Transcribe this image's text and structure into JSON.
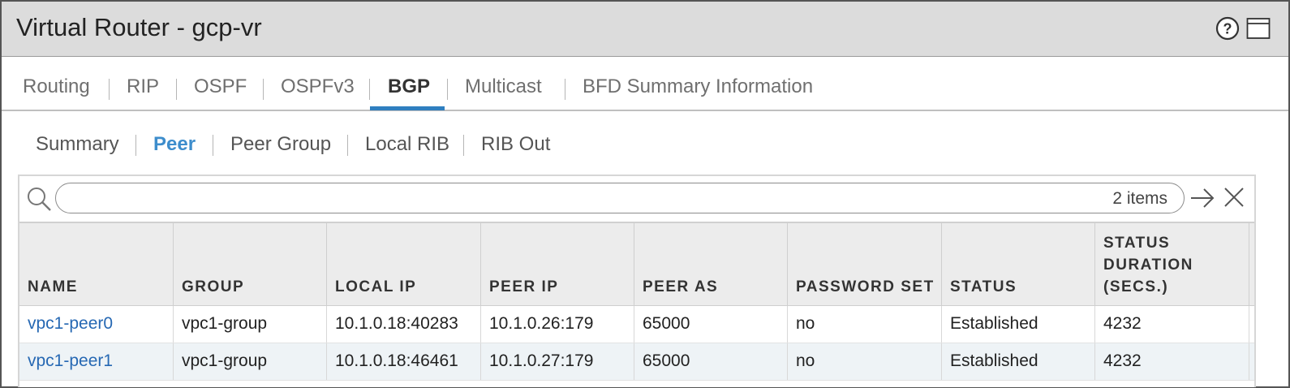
{
  "window": {
    "title": "Virtual Router - gcp-vr"
  },
  "tabs": [
    {
      "label": "Routing"
    },
    {
      "label": "RIP"
    },
    {
      "label": "OSPF"
    },
    {
      "label": "OSPFv3"
    },
    {
      "label": "BGP",
      "active": true
    },
    {
      "label": "Multicast"
    },
    {
      "label": "BFD Summary Information"
    }
  ],
  "subtabs": [
    {
      "label": "Summary"
    },
    {
      "label": "Peer",
      "active": true
    },
    {
      "label": "Peer Group"
    },
    {
      "label": "Local RIB"
    },
    {
      "label": "RIB Out"
    }
  ],
  "filter": {
    "value": "",
    "count": "2 items"
  },
  "table": {
    "columns": [
      "NAME",
      "GROUP",
      "LOCAL IP",
      "PEER IP",
      "PEER AS",
      "PASSWORD SET",
      "STATUS",
      "STATUS DURATION (SECS.)"
    ],
    "duration_header_lines": [
      "STATUS",
      "DURATION",
      "(SECS.)"
    ],
    "rows": [
      [
        "vpc1-peer0",
        "vpc1-group",
        "10.1.0.18:40283",
        "10.1.0.26:179",
        "65000",
        "no",
        "Established",
        "4232"
      ],
      [
        "vpc1-peer1",
        "vpc1-group",
        "10.1.0.18:46461",
        "10.1.0.27:179",
        "65000",
        "no",
        "Established",
        "4232"
      ]
    ]
  },
  "colors": {
    "accent": "#2f7fc0",
    "link": "#2668b3",
    "active_subtab": "#3d8dcc"
  },
  "icons": [
    "help-icon",
    "maximize-icon",
    "search-icon",
    "apply-filter-icon",
    "clear-filter-icon"
  ]
}
